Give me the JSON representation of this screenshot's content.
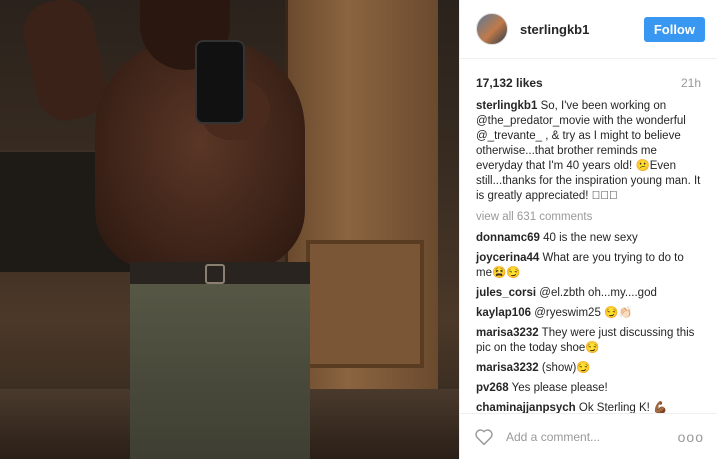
{
  "post": {
    "username": "sterlingkb1",
    "follow_label": "Follow",
    "likes": "17,132 likes",
    "time": "21h",
    "caption_user": "sterlingkb1",
    "caption_text": "So, I've been working on @the_predator_movie with the wonderful @_trevante_ , & try as I might to believe otherwise...that brother reminds me everyday that I'm 40 years old! 😕Even still...thanks for the inspiration young man. It is greatly appreciated! 🏻🏾🏿",
    "view_all": "view all 631 comments",
    "comments": [
      {
        "user": "donnamc69",
        "text": "40 is the new sexy"
      },
      {
        "user": "joycerina44",
        "text": "What are you trying to do to me😫😏"
      },
      {
        "user": "jules_corsi",
        "text": "@el.zbth oh...my....god"
      },
      {
        "user": "kaylap106",
        "text": "@ryeswim25 😏👏🏻"
      },
      {
        "user": "marisa3232",
        "text": "They were just discussing this pic on the today shoe😏"
      },
      {
        "user": "marisa3232",
        "text": "(show)😏"
      },
      {
        "user": "pv268",
        "text": "Yes please please!"
      },
      {
        "user": "chaminajjanpsych",
        "text": "Ok Sterling K! 💪🏾"
      }
    ],
    "add_comment_placeholder": "Add a comment...",
    "more_label": "ooo"
  },
  "colors": {
    "follow_bg": "#3897f0",
    "muted": "#999999",
    "text": "#262626"
  }
}
